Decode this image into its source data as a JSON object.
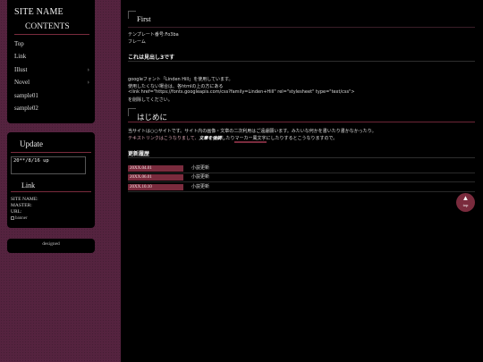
{
  "sidebar": {
    "site_name": "SITE NAME",
    "contents_heading": "CONTENTS",
    "menu": [
      {
        "label": "Top",
        "has_sub": false
      },
      {
        "label": "Link",
        "has_sub": false
      },
      {
        "label": "Illust",
        "has_sub": true
      },
      {
        "label": "Novel",
        "has_sub": true
      },
      {
        "label": "sample01",
        "has_sub": false
      },
      {
        "label": "sample02",
        "has_sub": false
      }
    ],
    "chevron": "›",
    "update_heading": "Update",
    "update_text": "20**/8/16 up",
    "link_heading": "Link",
    "site_name_label": "SITE NAME:",
    "master_label": "MASTER:",
    "url_label": "URL:",
    "banner_alt": "banner",
    "designed": "designed"
  },
  "main": {
    "first_heading": "First",
    "template_no": "テンプレート番号:Fo3ba",
    "frame": "フレーム",
    "h3_heading": "これは見出し3です",
    "font_line1": "googleフォント「Linden Hill」を使用しています。",
    "font_line2": "使用したくない場合は、各htmlの上の方にある",
    "font_line3": "<link href=\"https://fonts.googleapis.com/css?family=Linden+Hill\" rel=\"stylesheet\" type=\"text/css\">",
    "font_line4": "を削除してください。",
    "intro_heading": "はじめに",
    "intro_line1": "当サイトは○○サイトです。サイト内の画像・文章の二次利用はご遠慮願います。みたいな何かを書いたり書かなかったり。",
    "intro_pre": "テキストリンクはこうなりまして、",
    "intro_bold": "文章を強調",
    "intro_mid": "したり",
    "intro_mark": "マーカー風文字",
    "intro_post": "にしたりするとこうなりますので。",
    "history_heading": "更新履歴",
    "history": [
      {
        "date": "20XX.04.01",
        "text": "小説更新"
      },
      {
        "date": "20XX.06.01",
        "text": "小説更新"
      },
      {
        "date": "20XX.10.10",
        "text": "小説更新"
      }
    ]
  },
  "top_button": {
    "arrow": "▲",
    "label": "top"
  },
  "colors": {
    "accent": "#7a2b3d",
    "sidebar_bg": "#55233f",
    "page_bg": "#000000"
  }
}
